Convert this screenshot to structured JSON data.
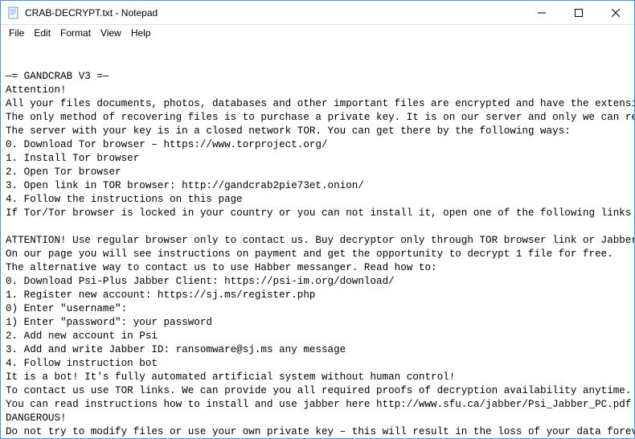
{
  "titlebar": {
    "title": "CRAB-DECRYPT.txt - Notepad"
  },
  "menubar": {
    "items": [
      "File",
      "Edit",
      "Format",
      "View",
      "Help"
    ]
  },
  "content": {
    "lines": [
      "—= GANDCRAB V3 =—",
      "Attention!",
      "All your files documents, photos, databases and other important files are encrypted and have the extension: .CRAB",
      "The only method of recovering files is to purchase a private key. It is on our server and only we can recover you",
      "The server with your key is in a closed network TOR. You can get there by the following ways:",
      "0. Download Tor browser – https://www.torproject.org/",
      "1. Install Tor browser",
      "2. Open Tor browser",
      "3. Open link in TOR browser: http://gandcrab2pie73et.onion/",
      "4. Follow the instructions on this page",
      "If Tor/Tor browser is locked in your country or you can not install it, open one of the following links in your r",
      "",
      "ATTENTION! Use regular browser only to contact us. Buy decryptor only through TOR browser link or Jabber Bot!",
      "On our page you will see instructions on payment and get the opportunity to decrypt 1 file for free.",
      "The alternative way to contact us to use Habber messanger. Read how to:",
      "0. Download Psi-Plus Jabber Client: https://psi-im.org/download/",
      "1. Register new account: https://sj.ms/register.php",
      "0) Enter \"username\":",
      "1) Enter \"password\": your password",
      "2. Add new account in Psi",
      "3. Add and write Jabber ID: ransomware@sj.ms any message",
      "4. Follow instruction bot",
      "It is a bot! It's fully automated artificial system without human control!",
      "To contact us use TOR links. We can provide you all required proofs of decryption availability anytime. We are op",
      "You can read instructions how to install and use jabber here http://www.sfu.ca/jabber/Psi_Jabber_PC.pdf",
      "DANGEROUS!",
      "Do not try to modify files or use your own private key – this will result in the loss of your data forever!"
    ]
  }
}
